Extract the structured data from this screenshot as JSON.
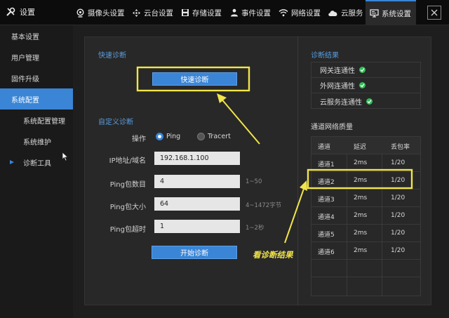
{
  "app": {
    "settings_label": "设置"
  },
  "nav": [
    {
      "label": "摄像头设置",
      "icon": "camera-icon"
    },
    {
      "label": "云台设置",
      "icon": "ptz-icon"
    },
    {
      "label": "存储设置",
      "icon": "save-icon"
    },
    {
      "label": "事件设置",
      "icon": "event-icon"
    },
    {
      "label": "网络设置",
      "icon": "wifi-icon"
    },
    {
      "label": "云服务",
      "icon": "cloud-icon"
    },
    {
      "label": "系统设置",
      "icon": "monitor-icon",
      "active": true
    }
  ],
  "sidebar": {
    "items": [
      {
        "label": "基本设置"
      },
      {
        "label": "用户管理"
      },
      {
        "label": "固件升级"
      },
      {
        "label": "系统配置",
        "active": true
      },
      {
        "label": "系统配置管理"
      },
      {
        "label": "系统维护"
      },
      {
        "label": "诊断工具"
      }
    ]
  },
  "quick": {
    "title": "快速诊断",
    "button": "快速诊断"
  },
  "custom": {
    "title": "自定义诊断",
    "op_label": "操作",
    "options": [
      {
        "label": "Ping",
        "selected": true
      },
      {
        "label": "Tracert",
        "selected": false
      }
    ],
    "fields": [
      {
        "label": "IP地址/域名",
        "value": "192.168.1.100",
        "hint": ""
      },
      {
        "label": "Ping包数目",
        "value": "4",
        "hint": "1~50"
      },
      {
        "label": "Ping包大小",
        "value": "64",
        "hint": "4~1472字节"
      },
      {
        "label": "Ping包超时",
        "value": "1",
        "hint": "1~2秒"
      }
    ],
    "start_button": "开始诊断"
  },
  "result": {
    "title": "诊断结果",
    "items": [
      {
        "label": "网关连通性",
        "status": "ok"
      },
      {
        "label": "外网连通性",
        "status": "ok"
      },
      {
        "label": "云服务连通性",
        "status": "ok"
      }
    ]
  },
  "quality": {
    "title": "通道网络质量",
    "headers": [
      "通道",
      "延迟",
      "丢包率"
    ],
    "rows": [
      [
        "通道1",
        "2ms",
        "1/20"
      ],
      [
        "通道2",
        "2ms",
        "1/20"
      ],
      [
        "通道3",
        "2ms",
        "1/20"
      ],
      [
        "通道4",
        "2ms",
        "1/20"
      ],
      [
        "通道5",
        "2ms",
        "1/20"
      ],
      [
        "通道6",
        "2ms",
        "1/20"
      ]
    ]
  },
  "annotation": {
    "text": "看诊断结果"
  },
  "colors": {
    "accent": "#3a85d6",
    "highlight": "#f2e44a",
    "ok": "#2fbf55"
  }
}
